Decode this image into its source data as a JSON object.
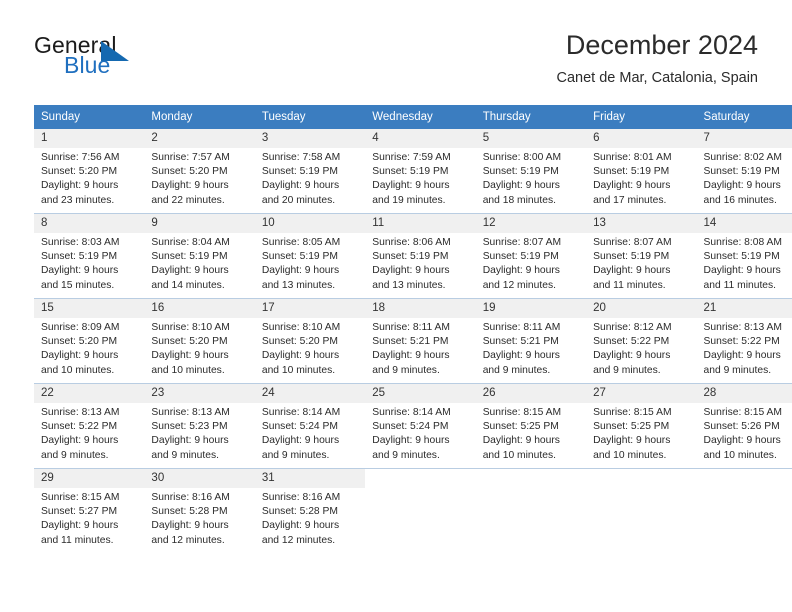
{
  "brand": {
    "name_part1": "General",
    "name_part2": "Blue",
    "accent_color": "#1569b0"
  },
  "header": {
    "title": "December 2024",
    "subtitle": "Canet de Mar, Catalonia, Spain"
  },
  "calendar": {
    "header_bg": "#3b7dc0",
    "weekday_headers": [
      "Sunday",
      "Monday",
      "Tuesday",
      "Wednesday",
      "Thursday",
      "Friday",
      "Saturday"
    ],
    "weeks": [
      [
        {
          "day": "1",
          "sunrise": "Sunrise: 7:56 AM",
          "sunset": "Sunset: 5:20 PM",
          "daylight1": "Daylight: 9 hours",
          "daylight2": "and 23 minutes."
        },
        {
          "day": "2",
          "sunrise": "Sunrise: 7:57 AM",
          "sunset": "Sunset: 5:20 PM",
          "daylight1": "Daylight: 9 hours",
          "daylight2": "and 22 minutes."
        },
        {
          "day": "3",
          "sunrise": "Sunrise: 7:58 AM",
          "sunset": "Sunset: 5:19 PM",
          "daylight1": "Daylight: 9 hours",
          "daylight2": "and 20 minutes."
        },
        {
          "day": "4",
          "sunrise": "Sunrise: 7:59 AM",
          "sunset": "Sunset: 5:19 PM",
          "daylight1": "Daylight: 9 hours",
          "daylight2": "and 19 minutes."
        },
        {
          "day": "5",
          "sunrise": "Sunrise: 8:00 AM",
          "sunset": "Sunset: 5:19 PM",
          "daylight1": "Daylight: 9 hours",
          "daylight2": "and 18 minutes."
        },
        {
          "day": "6",
          "sunrise": "Sunrise: 8:01 AM",
          "sunset": "Sunset: 5:19 PM",
          "daylight1": "Daylight: 9 hours",
          "daylight2": "and 17 minutes."
        },
        {
          "day": "7",
          "sunrise": "Sunrise: 8:02 AM",
          "sunset": "Sunset: 5:19 PM",
          "daylight1": "Daylight: 9 hours",
          "daylight2": "and 16 minutes."
        }
      ],
      [
        {
          "day": "8",
          "sunrise": "Sunrise: 8:03 AM",
          "sunset": "Sunset: 5:19 PM",
          "daylight1": "Daylight: 9 hours",
          "daylight2": "and 15 minutes."
        },
        {
          "day": "9",
          "sunrise": "Sunrise: 8:04 AM",
          "sunset": "Sunset: 5:19 PM",
          "daylight1": "Daylight: 9 hours",
          "daylight2": "and 14 minutes."
        },
        {
          "day": "10",
          "sunrise": "Sunrise: 8:05 AM",
          "sunset": "Sunset: 5:19 PM",
          "daylight1": "Daylight: 9 hours",
          "daylight2": "and 13 minutes."
        },
        {
          "day": "11",
          "sunrise": "Sunrise: 8:06 AM",
          "sunset": "Sunset: 5:19 PM",
          "daylight1": "Daylight: 9 hours",
          "daylight2": "and 13 minutes."
        },
        {
          "day": "12",
          "sunrise": "Sunrise: 8:07 AM",
          "sunset": "Sunset: 5:19 PM",
          "daylight1": "Daylight: 9 hours",
          "daylight2": "and 12 minutes."
        },
        {
          "day": "13",
          "sunrise": "Sunrise: 8:07 AM",
          "sunset": "Sunset: 5:19 PM",
          "daylight1": "Daylight: 9 hours",
          "daylight2": "and 11 minutes."
        },
        {
          "day": "14",
          "sunrise": "Sunrise: 8:08 AM",
          "sunset": "Sunset: 5:19 PM",
          "daylight1": "Daylight: 9 hours",
          "daylight2": "and 11 minutes."
        }
      ],
      [
        {
          "day": "15",
          "sunrise": "Sunrise: 8:09 AM",
          "sunset": "Sunset: 5:20 PM",
          "daylight1": "Daylight: 9 hours",
          "daylight2": "and 10 minutes."
        },
        {
          "day": "16",
          "sunrise": "Sunrise: 8:10 AM",
          "sunset": "Sunset: 5:20 PM",
          "daylight1": "Daylight: 9 hours",
          "daylight2": "and 10 minutes."
        },
        {
          "day": "17",
          "sunrise": "Sunrise: 8:10 AM",
          "sunset": "Sunset: 5:20 PM",
          "daylight1": "Daylight: 9 hours",
          "daylight2": "and 10 minutes."
        },
        {
          "day": "18",
          "sunrise": "Sunrise: 8:11 AM",
          "sunset": "Sunset: 5:21 PM",
          "daylight1": "Daylight: 9 hours",
          "daylight2": "and 9 minutes."
        },
        {
          "day": "19",
          "sunrise": "Sunrise: 8:11 AM",
          "sunset": "Sunset: 5:21 PM",
          "daylight1": "Daylight: 9 hours",
          "daylight2": "and 9 minutes."
        },
        {
          "day": "20",
          "sunrise": "Sunrise: 8:12 AM",
          "sunset": "Sunset: 5:22 PM",
          "daylight1": "Daylight: 9 hours",
          "daylight2": "and 9 minutes."
        },
        {
          "day": "21",
          "sunrise": "Sunrise: 8:13 AM",
          "sunset": "Sunset: 5:22 PM",
          "daylight1": "Daylight: 9 hours",
          "daylight2": "and 9 minutes."
        }
      ],
      [
        {
          "day": "22",
          "sunrise": "Sunrise: 8:13 AM",
          "sunset": "Sunset: 5:22 PM",
          "daylight1": "Daylight: 9 hours",
          "daylight2": "and 9 minutes."
        },
        {
          "day": "23",
          "sunrise": "Sunrise: 8:13 AM",
          "sunset": "Sunset: 5:23 PM",
          "daylight1": "Daylight: 9 hours",
          "daylight2": "and 9 minutes."
        },
        {
          "day": "24",
          "sunrise": "Sunrise: 8:14 AM",
          "sunset": "Sunset: 5:24 PM",
          "daylight1": "Daylight: 9 hours",
          "daylight2": "and 9 minutes."
        },
        {
          "day": "25",
          "sunrise": "Sunrise: 8:14 AM",
          "sunset": "Sunset: 5:24 PM",
          "daylight1": "Daylight: 9 hours",
          "daylight2": "and 9 minutes."
        },
        {
          "day": "26",
          "sunrise": "Sunrise: 8:15 AM",
          "sunset": "Sunset: 5:25 PM",
          "daylight1": "Daylight: 9 hours",
          "daylight2": "and 10 minutes."
        },
        {
          "day": "27",
          "sunrise": "Sunrise: 8:15 AM",
          "sunset": "Sunset: 5:25 PM",
          "daylight1": "Daylight: 9 hours",
          "daylight2": "and 10 minutes."
        },
        {
          "day": "28",
          "sunrise": "Sunrise: 8:15 AM",
          "sunset": "Sunset: 5:26 PM",
          "daylight1": "Daylight: 9 hours",
          "daylight2": "and 10 minutes."
        }
      ],
      [
        {
          "day": "29",
          "sunrise": "Sunrise: 8:15 AM",
          "sunset": "Sunset: 5:27 PM",
          "daylight1": "Daylight: 9 hours",
          "daylight2": "and 11 minutes."
        },
        {
          "day": "30",
          "sunrise": "Sunrise: 8:16 AM",
          "sunset": "Sunset: 5:28 PM",
          "daylight1": "Daylight: 9 hours",
          "daylight2": "and 12 minutes."
        },
        {
          "day": "31",
          "sunrise": "Sunrise: 8:16 AM",
          "sunset": "Sunset: 5:28 PM",
          "daylight1": "Daylight: 9 hours",
          "daylight2": "and 12 minutes."
        },
        {
          "day": "",
          "sunrise": "",
          "sunset": "",
          "daylight1": "",
          "daylight2": ""
        },
        {
          "day": "",
          "sunrise": "",
          "sunset": "",
          "daylight1": "",
          "daylight2": ""
        },
        {
          "day": "",
          "sunrise": "",
          "sunset": "",
          "daylight1": "",
          "daylight2": ""
        },
        {
          "day": "",
          "sunrise": "",
          "sunset": "",
          "daylight1": "",
          "daylight2": ""
        }
      ]
    ]
  }
}
